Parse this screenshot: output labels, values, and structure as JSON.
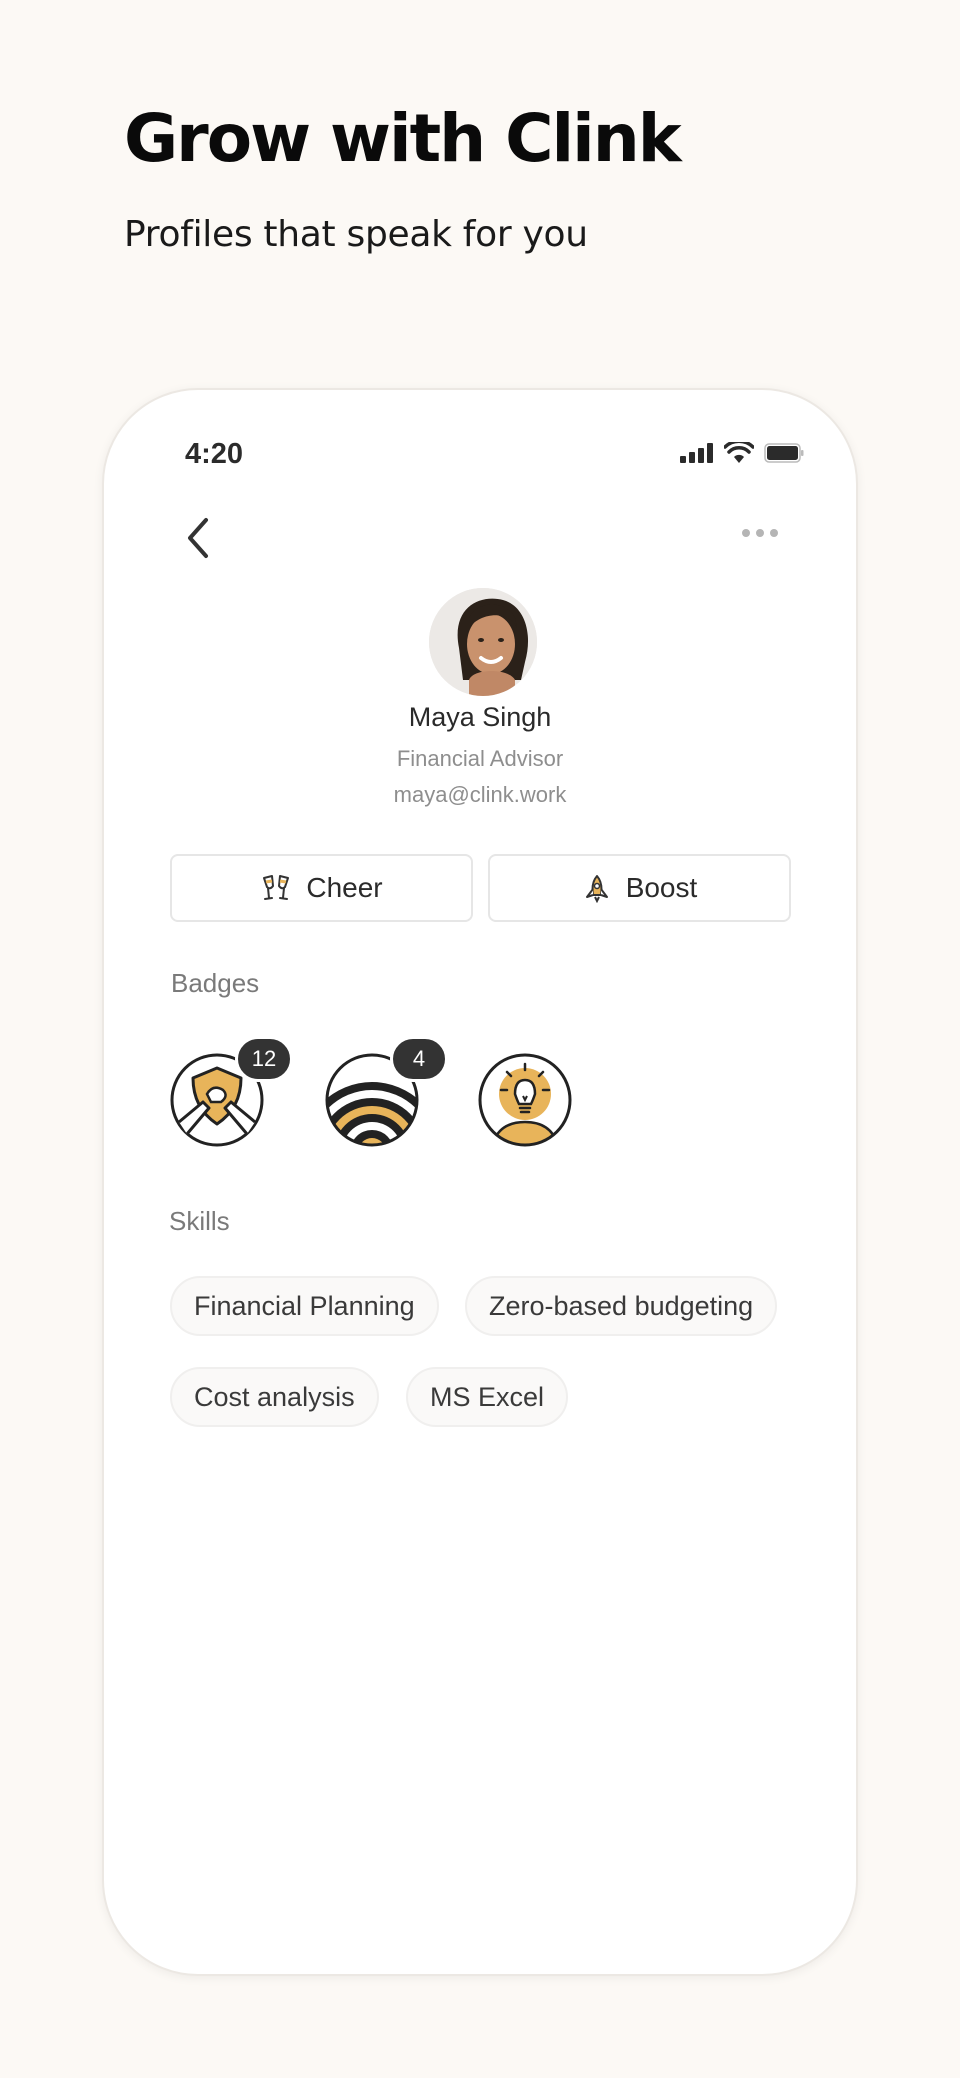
{
  "promo": {
    "headline": "Grow with Clink",
    "subheadline": "Profiles that speak for you"
  },
  "status_bar": {
    "time": "4:20"
  },
  "profile": {
    "name": "Maya Singh",
    "role": "Financial Advisor",
    "email": "maya@clink.work"
  },
  "actions": {
    "cheer_label": "Cheer",
    "boost_label": "Boost"
  },
  "badges": {
    "label": "Badges",
    "items": [
      {
        "icon": "handshake-shield-badge-icon",
        "count": "12"
      },
      {
        "icon": "signal-waves-badge-icon",
        "count": "4"
      },
      {
        "icon": "lightbulb-idea-badge-icon"
      }
    ]
  },
  "skills": {
    "label": "Skills",
    "items": [
      "Financial Planning",
      "Zero-based budgeting",
      "Cost analysis",
      "MS Excel"
    ]
  },
  "colors": {
    "accent": "#e8b45a",
    "background": "#fcf9f5",
    "badge_count_bg": "#333333"
  }
}
